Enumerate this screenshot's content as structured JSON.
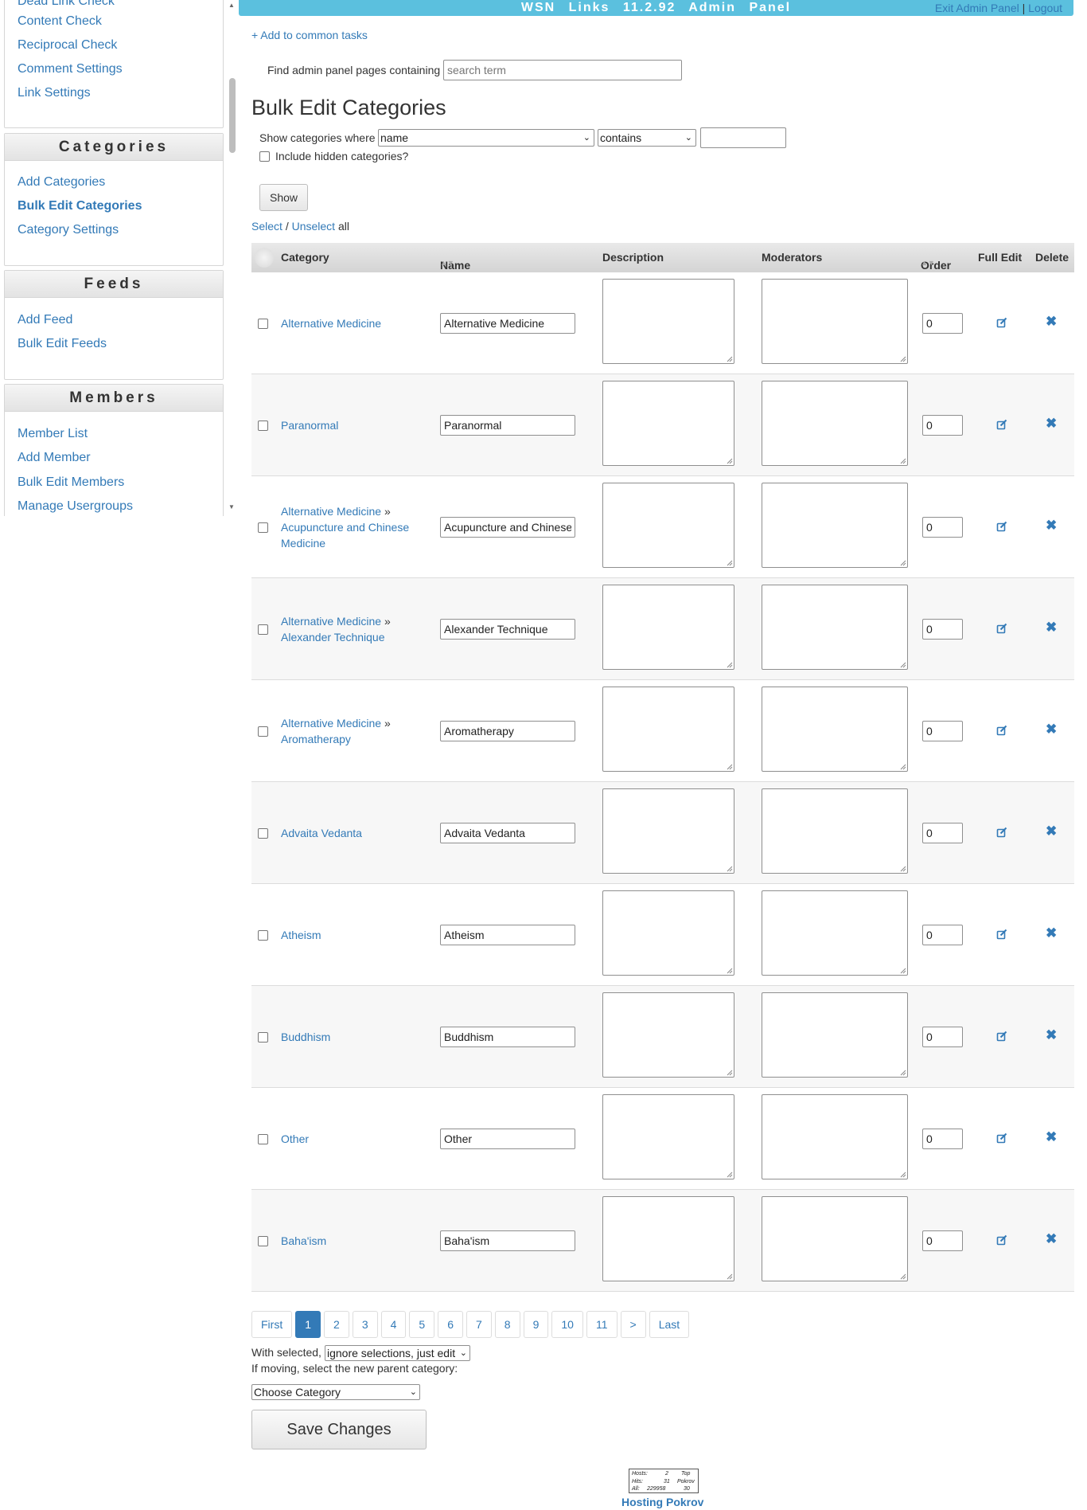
{
  "topbar": {
    "title": "WSN Links 11.2.92 Admin Panel",
    "exit_label": "Exit Admin Panel",
    "separator": "|",
    "logout_label": "Logout"
  },
  "sidebar": {
    "partial_top_item": "Dead Link Check",
    "top_items": [
      "Content Check",
      "Reciprocal Check",
      "Comment Settings",
      "Link Settings"
    ],
    "categories": {
      "heading": "Categories",
      "items": [
        "Add Categories",
        "Bulk Edit Categories",
        "Category Settings"
      ],
      "active": "Bulk Edit Categories"
    },
    "feeds": {
      "heading": "Feeds",
      "items": [
        "Add Feed",
        "Bulk Edit Feeds"
      ]
    },
    "members": {
      "heading": "Members",
      "items": [
        "Member List",
        "Add Member",
        "Bulk Edit Members",
        "Manage Usergroups"
      ]
    }
  },
  "main": {
    "add_common_tasks": "+ Add to common tasks",
    "find_label": "Find admin panel pages containing",
    "find_placeholder": "search term",
    "page_title": "Bulk Edit Categories",
    "filter": {
      "label": "Show categories where",
      "field_value": "name",
      "operator_value": "contains",
      "term_value": "",
      "include_hidden_label": "Include hidden categories?",
      "show_button": "Show"
    },
    "select_label": "Select",
    "slash": "/",
    "unselect_label": "Unselect",
    "all_label": "all",
    "columns": [
      "Category",
      "Name",
      "Description",
      "Moderators",
      "Order",
      "Full Edit",
      "Delete"
    ],
    "rows": [
      {
        "category_parts": [
          "Alternative Medicine"
        ],
        "name": "Alternative Medicine",
        "order": "0"
      },
      {
        "category_parts": [
          "Paranormal"
        ],
        "name": "Paranormal",
        "order": "0"
      },
      {
        "category_parts": [
          "Alternative Medicine",
          "Acupuncture and Chinese Medicine"
        ],
        "name": "Acupuncture and Chinese",
        "order": "0"
      },
      {
        "category_parts": [
          "Alternative Medicine",
          "Alexander Technique"
        ],
        "name": "Alexander Technique",
        "order": "0"
      },
      {
        "category_parts": [
          "Alternative Medicine",
          "Aromatherapy"
        ],
        "name": "Aromatherapy",
        "order": "0"
      },
      {
        "category_parts": [
          "Advaita Vedanta"
        ],
        "name": "Advaita Vedanta",
        "order": "0"
      },
      {
        "category_parts": [
          "Atheism"
        ],
        "name": "Atheism",
        "order": "0"
      },
      {
        "category_parts": [
          "Buddhism"
        ],
        "name": "Buddhism",
        "order": "0"
      },
      {
        "category_parts": [
          "Other"
        ],
        "name": "Other",
        "order": "0"
      },
      {
        "category_parts": [
          "Baha'ism"
        ],
        "name": "Baha'ism",
        "order": "0"
      }
    ],
    "pagination": [
      "First",
      "1",
      "2",
      "3",
      "4",
      "5",
      "6",
      "7",
      "8",
      "9",
      "10",
      "11",
      ">",
      "Last"
    ],
    "current_page": "1",
    "with_selected_label": "With selected,",
    "with_selected_value": "ignore selections, just edit",
    "moving_label": "If moving, select the new parent category:",
    "parent_category_value": "Choose Category",
    "save_button": "Save Changes",
    "footer": {
      "counter": {
        "hosts_label": "Hosts:",
        "hosts": "2",
        "hits_label": "Hits:",
        "hits": "31",
        "all_label": "All:",
        "all": "229958",
        "top": "Top",
        "pokrov": "Pokrov",
        "rank": "30"
      },
      "link_label": "Hosting Pokrov"
    }
  },
  "colors": {
    "topbar": "#5bc0de",
    "link": "#337ab7",
    "active_page": "#337ab7"
  }
}
